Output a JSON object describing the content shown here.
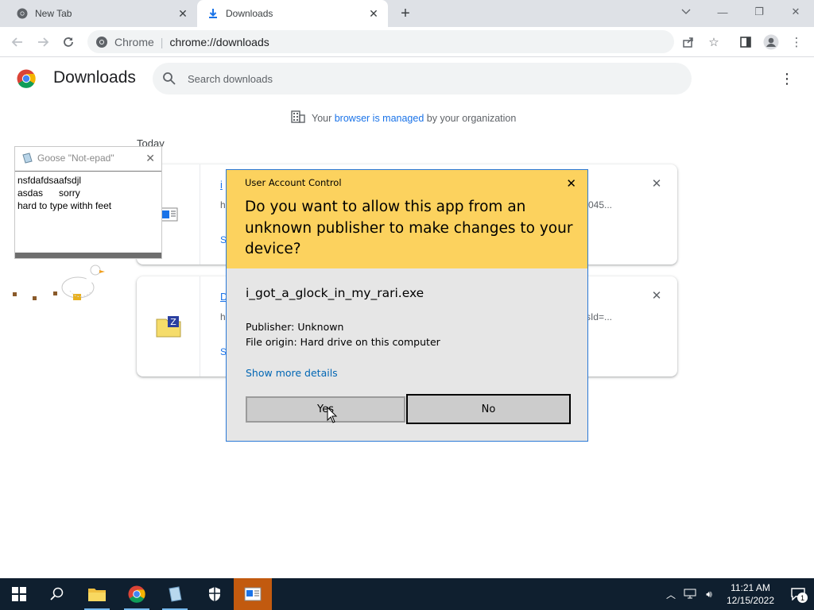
{
  "browser": {
    "tabs": [
      {
        "title": "New Tab",
        "icon": "chrome-icon",
        "active": false
      },
      {
        "title": "Downloads",
        "icon": "download-icon",
        "active": true
      }
    ],
    "omnibox": {
      "chip": "Chrome",
      "url": "chrome://downloads"
    }
  },
  "downloads": {
    "title": "Downloads",
    "search_placeholder": "Search downloads",
    "managed": {
      "prefix": "Your ",
      "link": "browser is managed",
      "suffix": " by your organization"
    },
    "group_label": "Today",
    "items": [
      {
        "name": "i",
        "url": "h",
        "url_end": "045...",
        "action": "S",
        "icon": "installer-icon"
      },
      {
        "name": "D",
        "url": "h",
        "url_end": "sId=...",
        "action": "S",
        "icon": "zip-folder-icon"
      }
    ]
  },
  "notepad": {
    "title": "Goose \"Not-epad\"",
    "text": "nsfdafdsaafsdjl\nasdas      sorry\nhard to type withh feet"
  },
  "uac": {
    "title": "User Account Control",
    "question": "Do you want to allow this app from an unknown publisher to make changes to your device?",
    "app_name": "i_got_a_glock_in_my_rari.exe",
    "publisher": "Publisher: Unknown",
    "origin": "File origin: Hard drive on this computer",
    "more_details": "Show more details",
    "yes": "Yes",
    "no": "No",
    "accent": "#fcd25e"
  },
  "taskbar": {
    "time": "11:21 AM",
    "date": "12/15/2022",
    "notifications": "1"
  }
}
